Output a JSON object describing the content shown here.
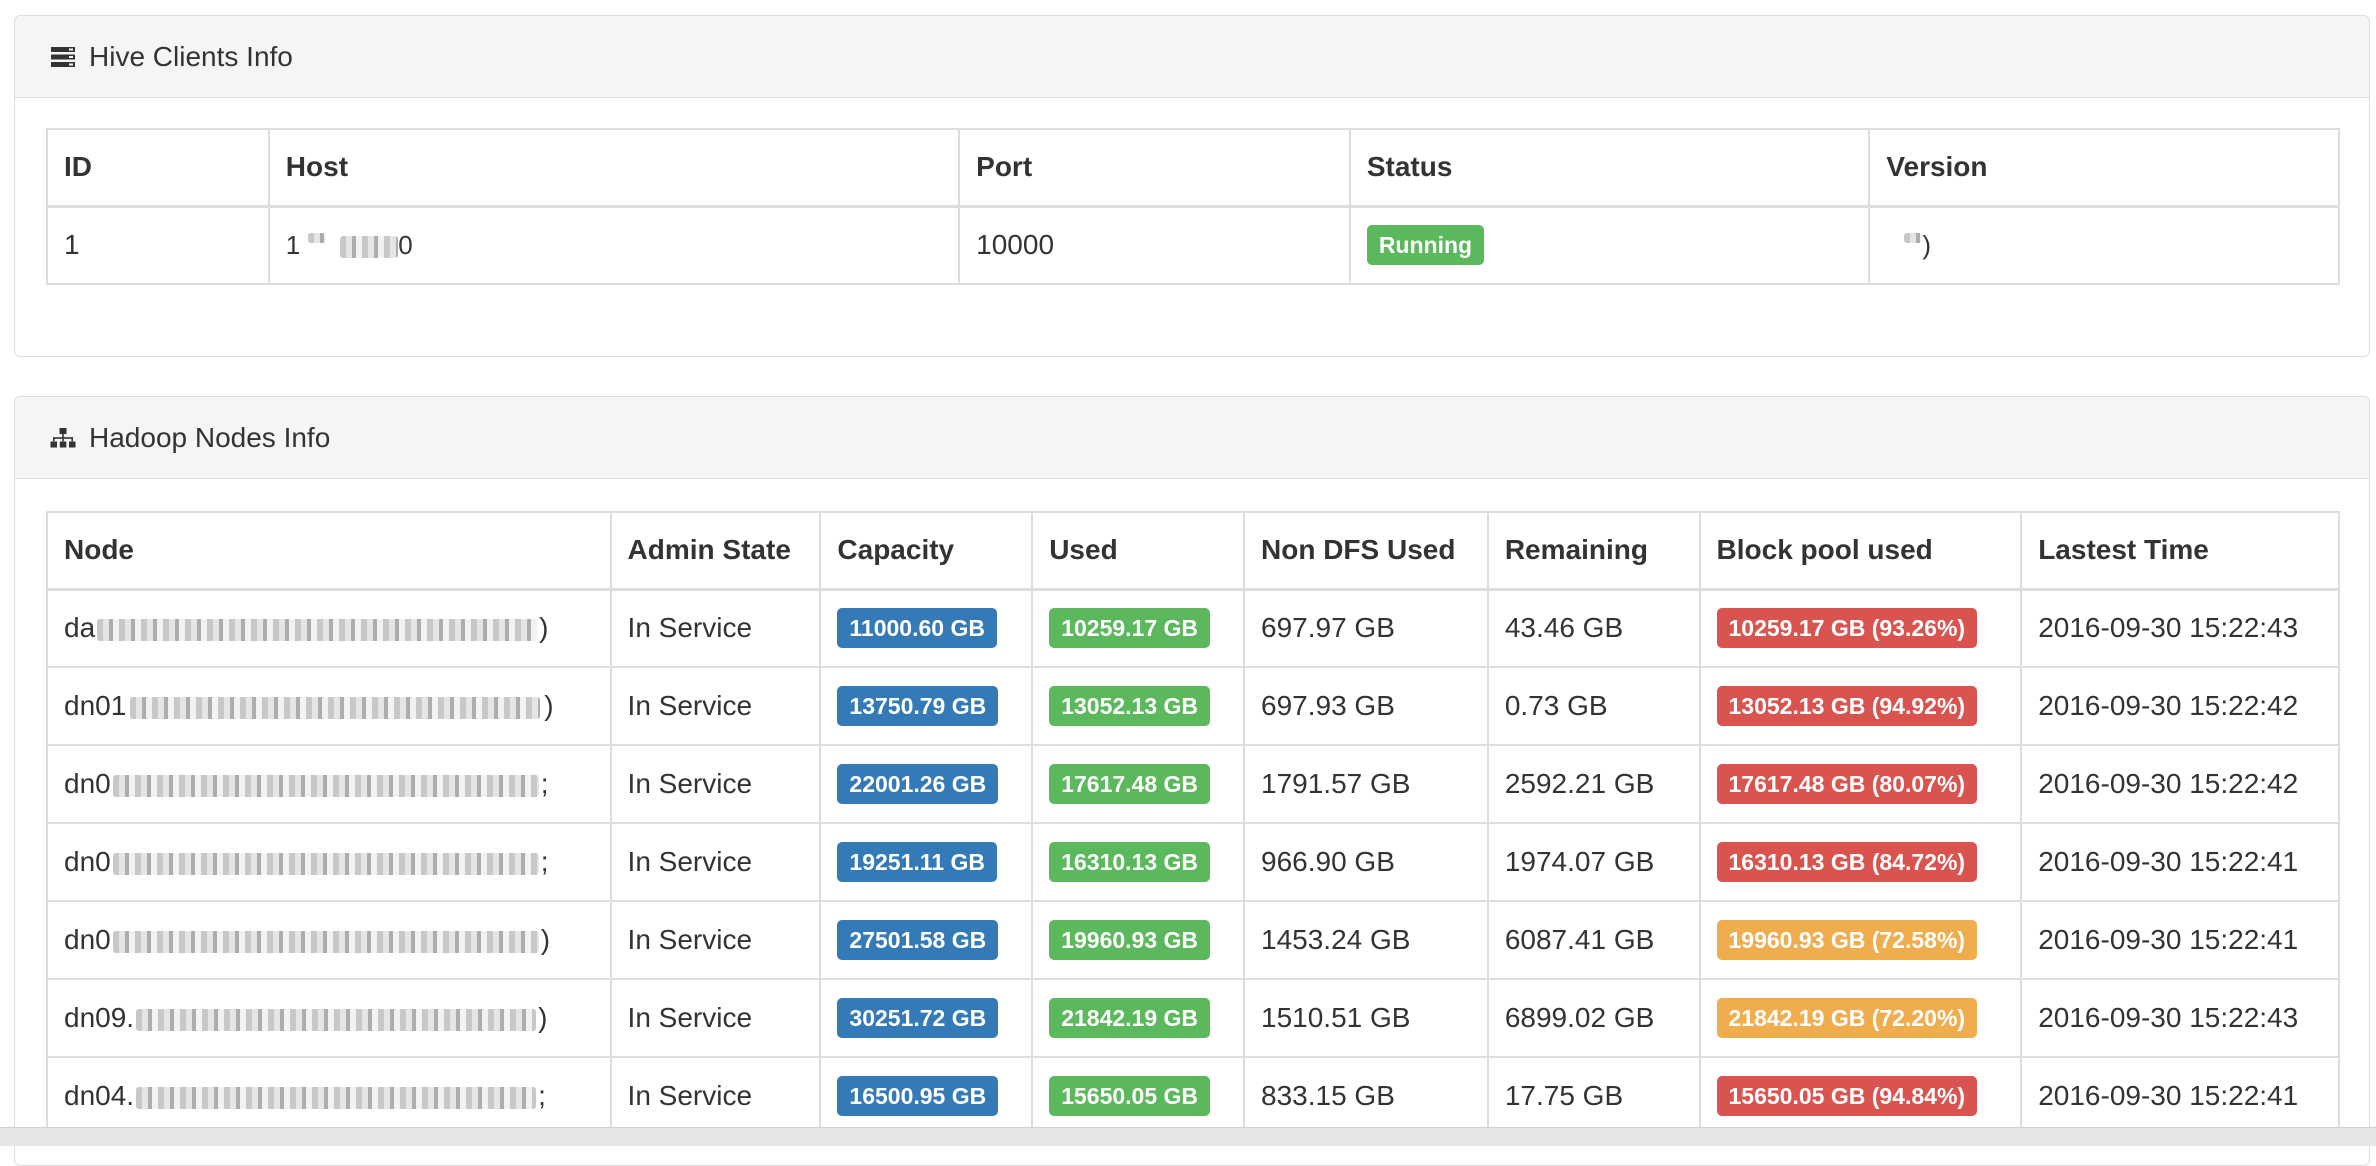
{
  "hive_panel": {
    "title": "Hive Clients Info",
    "icon": "server-icon",
    "columns": [
      "ID",
      "Host",
      "Port",
      "Status",
      "Version"
    ],
    "rows": [
      {
        "id": "1",
        "host": "1̀̀ ███ █.██0",
        "port": "10000",
        "status": "Running",
        "version": "̀̀)"
      }
    ]
  },
  "hadoop_panel": {
    "title": "Hadoop Nodes Info",
    "icon": "sitemap-icon",
    "columns": [
      "Node",
      "Admin State",
      "Capacity",
      "Used",
      "Non DFS Used",
      "Remaining",
      "Block pool used",
      "Lastest Time"
    ],
    "rows": [
      {
        "node_prefix": "da",
        "node_suffix": ")",
        "admin_state": "In Service",
        "capacity": "11000.60 GB",
        "used": "10259.17 GB",
        "non_dfs_used": "697.97 GB",
        "remaining": "43.46 GB",
        "block_pool_used": "10259.17 GB (93.26%)",
        "block_pool_level": "danger",
        "latest_time": "2016-09-30 15:22:43"
      },
      {
        "node_prefix": "dn01",
        "node_suffix": ")",
        "admin_state": "In Service",
        "capacity": "13750.79 GB",
        "used": "13052.13 GB",
        "non_dfs_used": "697.93 GB",
        "remaining": "0.73 GB",
        "block_pool_used": "13052.13 GB (94.92%)",
        "block_pool_level": "danger",
        "latest_time": "2016-09-30 15:22:42"
      },
      {
        "node_prefix": "dn0",
        "node_suffix": ";",
        "admin_state": "In Service",
        "capacity": "22001.26 GB",
        "used": "17617.48 GB",
        "non_dfs_used": "1791.57 GB",
        "remaining": "2592.21 GB",
        "block_pool_used": "17617.48 GB (80.07%)",
        "block_pool_level": "danger",
        "latest_time": "2016-09-30 15:22:42"
      },
      {
        "node_prefix": "dn0",
        "node_suffix": ";",
        "admin_state": "In Service",
        "capacity": "19251.11 GB",
        "used": "16310.13 GB",
        "non_dfs_used": "966.90 GB",
        "remaining": "1974.07 GB",
        "block_pool_used": "16310.13 GB (84.72%)",
        "block_pool_level": "danger",
        "latest_time": "2016-09-30 15:22:41"
      },
      {
        "node_prefix": "dn0",
        "node_suffix": ")",
        "admin_state": "In Service",
        "capacity": "27501.58 GB",
        "used": "19960.93 GB",
        "non_dfs_used": "1453.24 GB",
        "remaining": "6087.41 GB",
        "block_pool_used": "19960.93 GB (72.58%)",
        "block_pool_level": "warning",
        "latest_time": "2016-09-30 15:22:41"
      },
      {
        "node_prefix": "dn09.",
        "node_suffix": ")",
        "admin_state": "In Service",
        "capacity": "30251.72 GB",
        "used": "21842.19 GB",
        "non_dfs_used": "1510.51 GB",
        "remaining": "6899.02 GB",
        "block_pool_used": "21842.19 GB (72.20%)",
        "block_pool_level": "warning",
        "latest_time": "2016-09-30 15:22:43"
      },
      {
        "node_prefix": "dn04.",
        "node_suffix": ";",
        "admin_state": "In Service",
        "capacity": "16500.95 GB",
        "used": "15650.05 GB",
        "non_dfs_used": "833.15 GB",
        "remaining": "17.75 GB",
        "block_pool_used": "15650.05 GB (94.84%)",
        "block_pool_level": "danger",
        "latest_time": "2016-09-30 15:22:41"
      }
    ]
  },
  "colors": {
    "primary": "#337ab7",
    "success": "#5cb85c",
    "danger": "#d9534f",
    "warning": "#f0ad4e"
  }
}
